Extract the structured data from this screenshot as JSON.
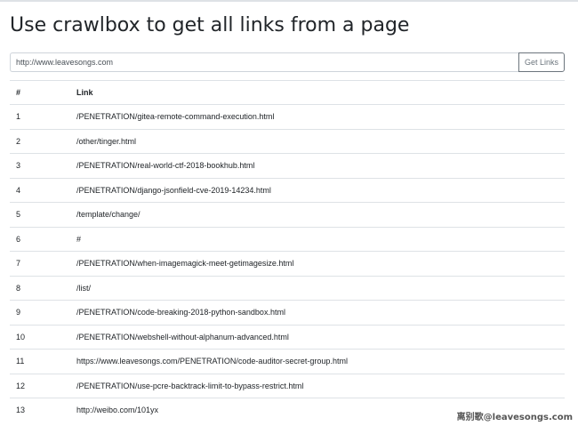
{
  "page": {
    "title": "Use crawlbox to get all links from a page"
  },
  "form": {
    "url_value": "http://www.leavesongs.com",
    "button_label": "Get Links"
  },
  "table": {
    "headers": [
      "#",
      "Link"
    ],
    "rows": [
      {
        "num": "1",
        "link": "/PENETRATION/gitea-remote-command-execution.html"
      },
      {
        "num": "2",
        "link": "/other/tinger.html"
      },
      {
        "num": "3",
        "link": "/PENETRATION/real-world-ctf-2018-bookhub.html"
      },
      {
        "num": "4",
        "link": "/PENETRATION/django-jsonfield-cve-2019-14234.html"
      },
      {
        "num": "5",
        "link": "/template/change/"
      },
      {
        "num": "6",
        "link": "#"
      },
      {
        "num": "7",
        "link": "/PENETRATION/when-imagemagick-meet-getimagesize.html"
      },
      {
        "num": "8",
        "link": "/list/"
      },
      {
        "num": "9",
        "link": "/PENETRATION/code-breaking-2018-python-sandbox.html"
      },
      {
        "num": "10",
        "link": "/PENETRATION/webshell-without-alphanum-advanced.html"
      },
      {
        "num": "11",
        "link": "https://www.leavesongs.com/PENETRATION/code-auditor-secret-group.html"
      },
      {
        "num": "12",
        "link": "/PENETRATION/use-pcre-backtrack-limit-to-bypass-restrict.html"
      },
      {
        "num": "13",
        "link": "http://weibo.com/101yx"
      }
    ]
  },
  "watermark": "离别歌@leavesongs.com"
}
